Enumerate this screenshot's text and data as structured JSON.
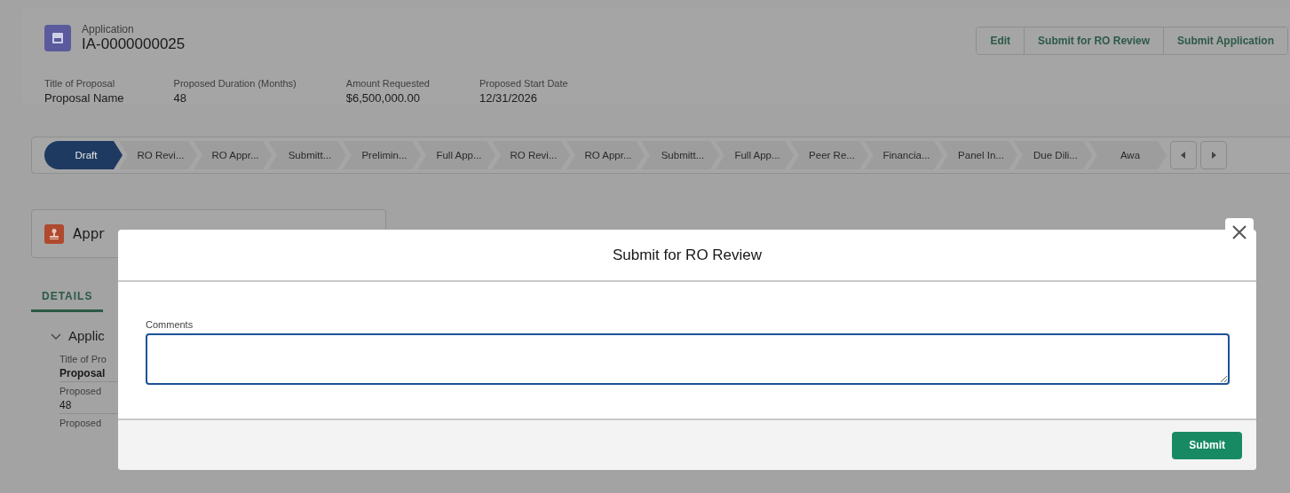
{
  "record": {
    "object_label": "Application",
    "name": "IA-0000000025"
  },
  "actions": [
    {
      "label": "Edit"
    },
    {
      "label": "Submit for RO Review"
    },
    {
      "label": "Submit Application"
    }
  ],
  "highlights": [
    {
      "label": "Title of Proposal",
      "value": "Proposal Name"
    },
    {
      "label": "Proposed Duration (Months)",
      "value": "48"
    },
    {
      "label": "Amount Requested",
      "value": "$6,500,000.00"
    },
    {
      "label": "Proposed Start Date",
      "value": "12/31/2026"
    }
  ],
  "path": {
    "stages": [
      {
        "label": "Draft",
        "selected": true
      },
      {
        "label": "RO Revi...",
        "selected": false
      },
      {
        "label": "RO Appr...",
        "selected": false
      },
      {
        "label": "Submitt...",
        "selected": false
      },
      {
        "label": "Prelimin...",
        "selected": false
      },
      {
        "label": "Full App...",
        "selected": false
      },
      {
        "label": "RO Revi...",
        "selected": false
      },
      {
        "label": "RO Appr...",
        "selected": false
      },
      {
        "label": "Submitt...",
        "selected": false
      },
      {
        "label": "Full App...",
        "selected": false
      },
      {
        "label": "Peer Re...",
        "selected": false
      },
      {
        "label": "Financia...",
        "selected": false
      },
      {
        "label": "Panel In...",
        "selected": false
      },
      {
        "label": "Due Dili...",
        "selected": false
      },
      {
        "label": "Awa",
        "selected": false
      }
    ]
  },
  "approvals_card": {
    "title": "Appr"
  },
  "tabs": [
    {
      "label": "DETAILS",
      "selected": true
    }
  ],
  "section": {
    "title": "Applic",
    "expanded": true,
    "fields": [
      {
        "label": "Title of Pro",
        "value": "Proposal"
      },
      {
        "label": "Proposed",
        "value": "48"
      },
      {
        "label": "Proposed"
      }
    ]
  },
  "modal": {
    "title": "Submit for RO Review",
    "field_label": "Comments",
    "submit_label": "Submit"
  }
}
